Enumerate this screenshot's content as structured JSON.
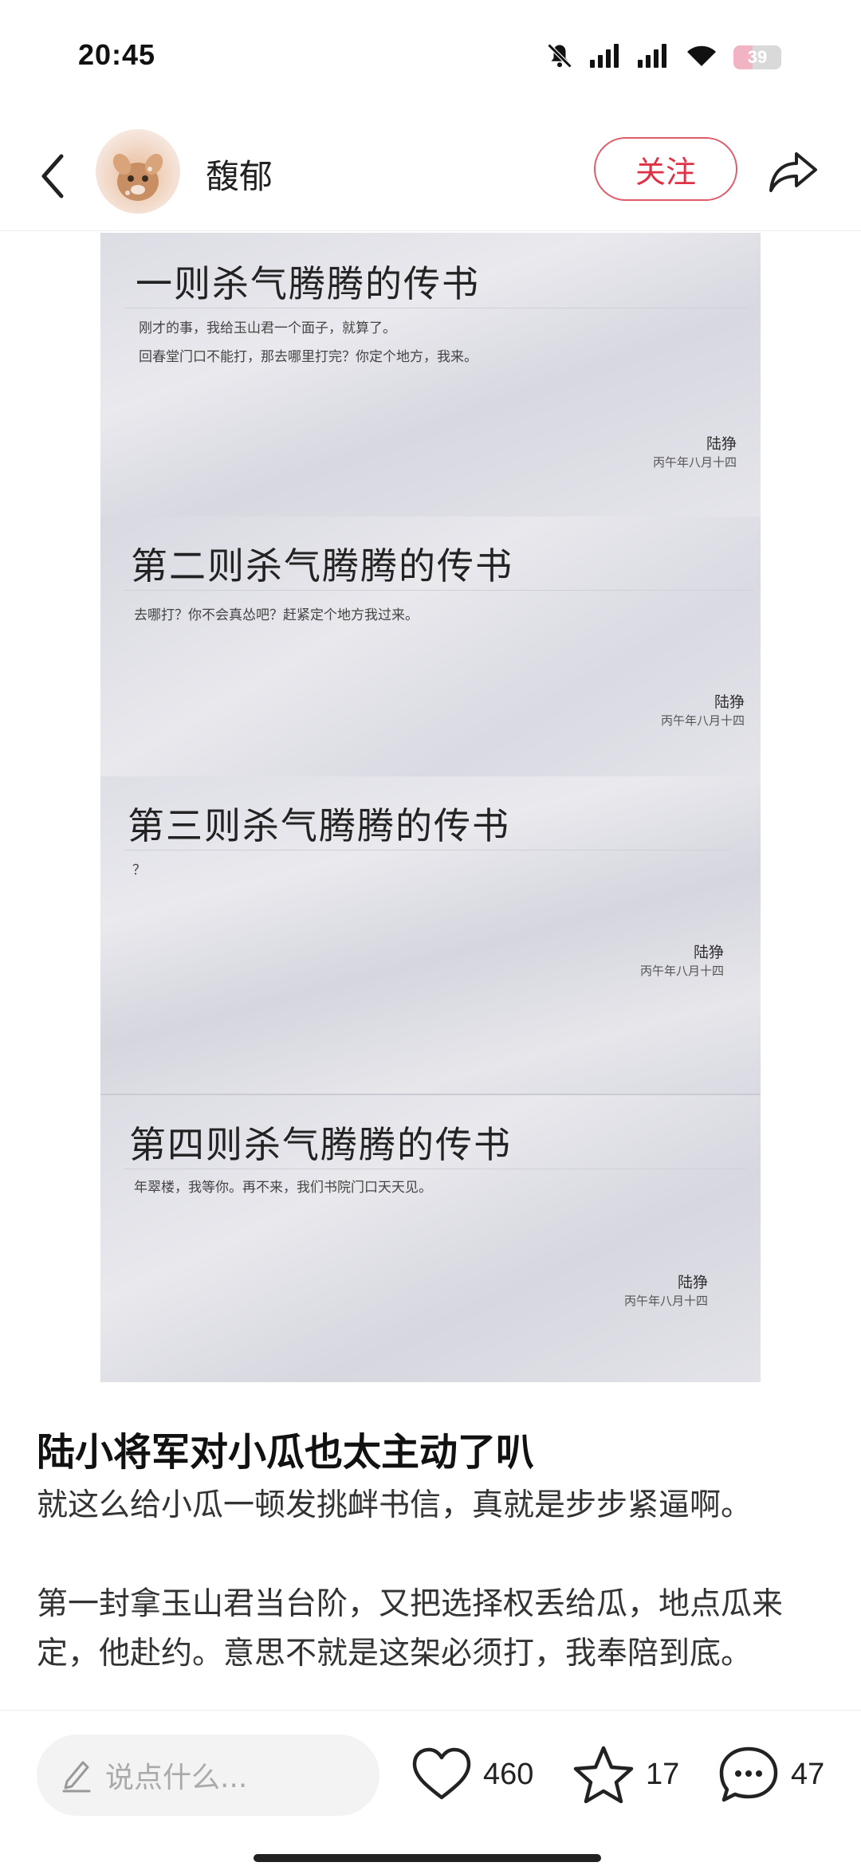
{
  "status_bar": {
    "time": "20:45",
    "battery_level": "39",
    "icons": [
      "bell-muted-icon",
      "signal-icon",
      "signal-icon",
      "wifi-icon",
      "battery-icon"
    ]
  },
  "header": {
    "author_name": "馥郁",
    "follow_label": "关注"
  },
  "image": {
    "letters": [
      {
        "title": "一则杀气腾腾的传书",
        "body_lines": [
          "刚才的事，我给玉山君一个面子，就算了。",
          "回春堂门口不能打，那去哪里打完？你定个地方，我来。"
        ],
        "signature": "陆狰",
        "date": "丙午年八月十四"
      },
      {
        "title": "第二则杀气腾腾的传书",
        "body_lines": [
          "去哪打？你不会真怂吧？赶紧定个地方我过来。"
        ],
        "signature": "陆狰",
        "date": "丙午年八月十四"
      },
      {
        "title": "第三则杀气腾腾的传书",
        "body_lines": [
          "？"
        ],
        "signature": "陆狰",
        "date": "丙午年八月十四"
      },
      {
        "title": "第四则杀气腾腾的传书",
        "body_lines": [
          "年翠楼，我等你。再不来，我们书院门口天天见。"
        ],
        "signature": "陆狰",
        "date": "丙午年八月十四"
      }
    ]
  },
  "post": {
    "title": "陆小将军对小瓜也太主动了叭",
    "paragraph_1": "就这么给小瓜一顿发挑衅书信，真就是步步紧逼啊。",
    "paragraph_2": "第一封拿玉山君当台阶，又把选择权丢给瓜，地点瓜来定，他赴约。意思不就是这架必须打，我奉陪到底。"
  },
  "bottom_bar": {
    "comment_placeholder": "说点什么...",
    "like_count": "460",
    "collect_count": "17",
    "comment_count": "47"
  }
}
